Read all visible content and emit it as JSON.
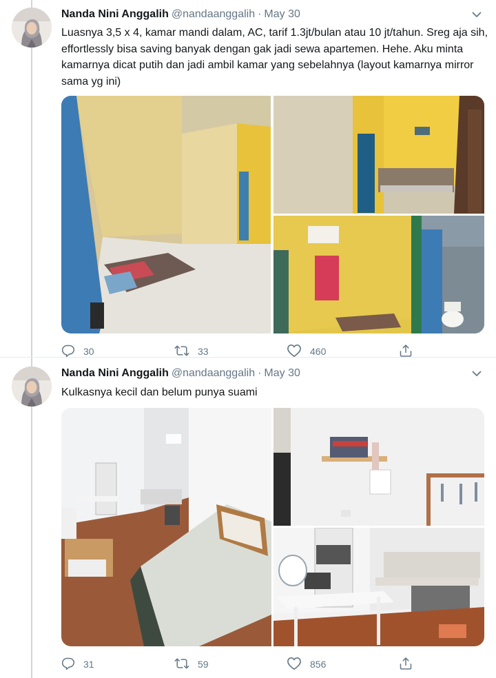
{
  "tweets": [
    {
      "author_name": "Nanda Nini Anggalih",
      "author_handle": "@nandaanggalih",
      "separator": "·",
      "date": "May 30",
      "text": "Luasnya 3,5 x 4, kamar mandi dalam, AC, tarif 1.3jt/bulan atau 10 jt/tahun. Sreg aja sih, effortlessly bisa saving banyak dengan gak jadi sewa apartemen. Hehe. Aku minta kamarnya dicat putih dan jadi ambil kamar yang sebelahnya (layout kamarnya mirror sama yg ini)",
      "replies": "30",
      "retweets": "33",
      "likes": "460"
    },
    {
      "author_name": "Nanda Nini Anggalih",
      "author_handle": "@nandaanggalih",
      "separator": "·",
      "date": "May 30",
      "text": "Kulkasnya kecil dan belum punya suami",
      "replies": "31",
      "retweets": "59",
      "likes": "856"
    }
  ],
  "icons": {
    "reply": "reply-icon",
    "retweet": "retweet-icon",
    "like": "heart-icon",
    "share": "share-icon",
    "caret": "chevron-down-icon"
  },
  "colors": {
    "text": "#14171a",
    "secondary": "#657786",
    "thread_line": "#ccd6dd",
    "wall_yellow": "#e8c23a",
    "door_blue": "#3f7fb0",
    "floor_wood": "#9a5a3a"
  }
}
